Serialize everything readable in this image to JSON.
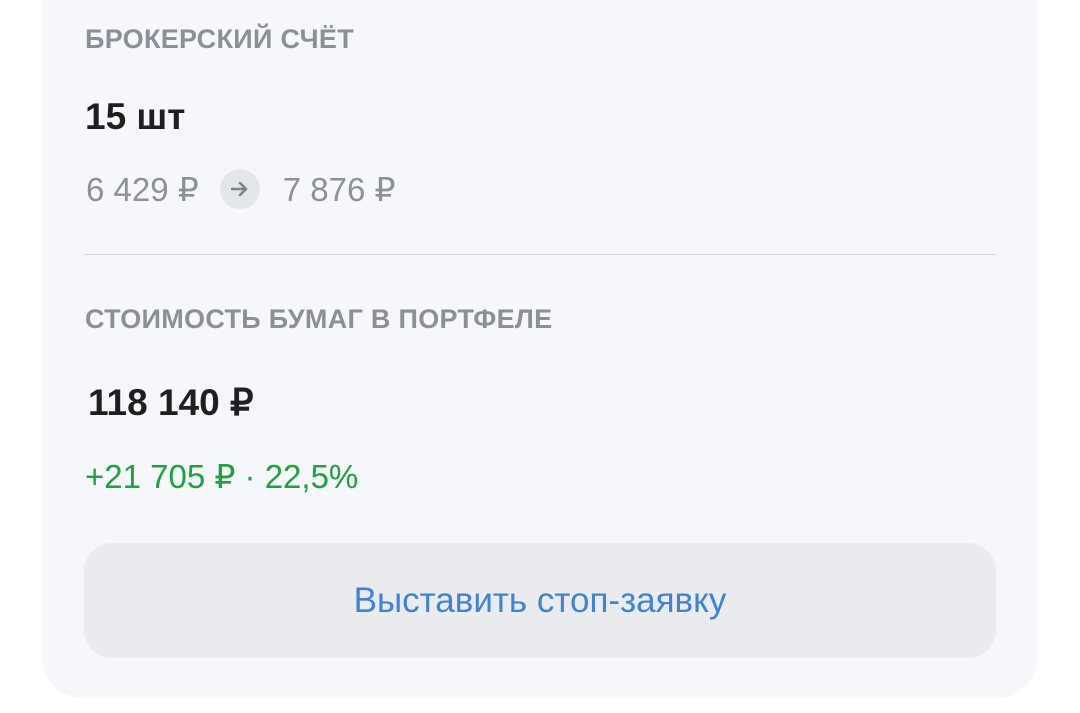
{
  "brokerage": {
    "label": "БРОКЕРСКИЙ СЧЁТ",
    "quantity": "15 шт",
    "avg_price": "6 429 ₽",
    "current_price": "7 876 ₽"
  },
  "portfolio": {
    "label": "СТОИМОСТЬ БУМАГ В ПОРТФЕЛЕ",
    "value": "118 140 ₽",
    "change": "+21 705 ₽ · 22,5%"
  },
  "actions": {
    "stop_order_label": "Выставить стоп-заявку"
  },
  "icons": {
    "price_arrow": "arrow-right-icon"
  },
  "colors": {
    "card_bg": "#f5f7fa",
    "gain": "#1fa23b",
    "accent": "#3f83d6",
    "muted": "#8c9198"
  }
}
